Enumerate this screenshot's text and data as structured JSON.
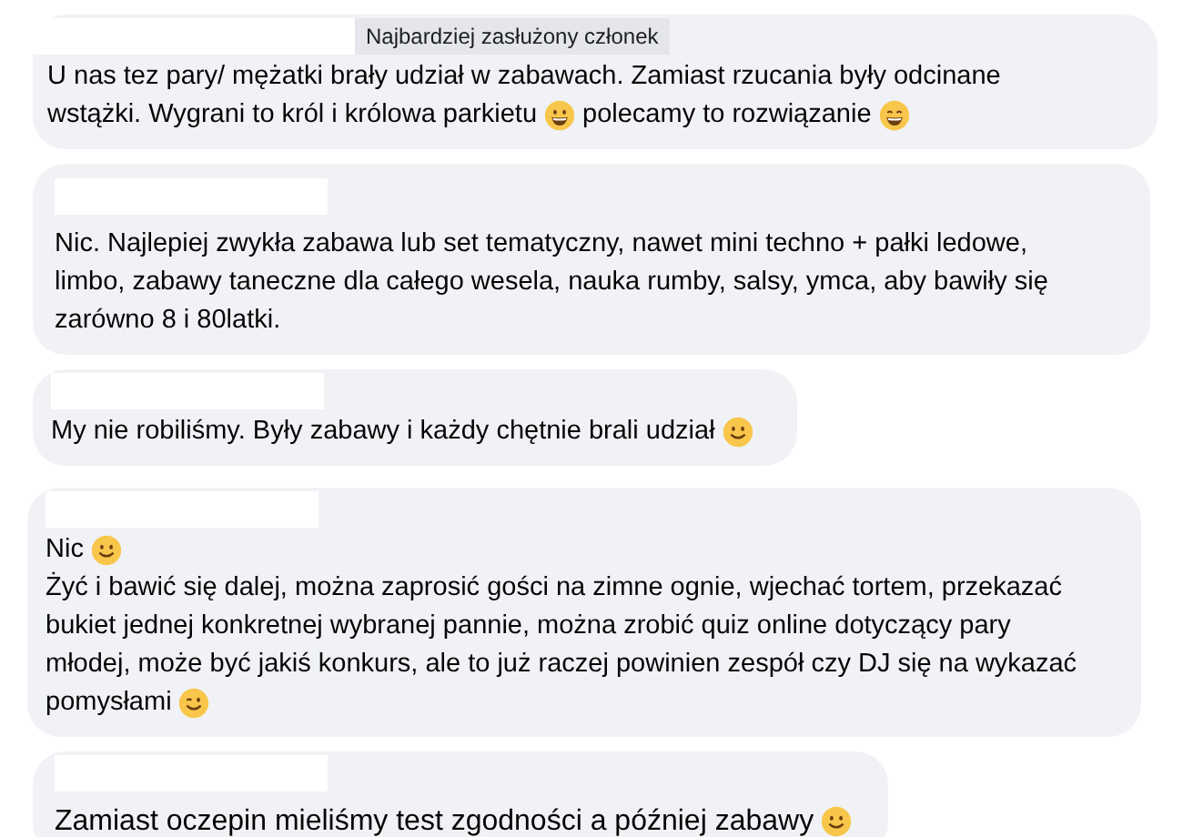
{
  "comments": [
    {
      "badge": "Najbardziej zasłużony członek",
      "lines": [
        [
          {
            "kind": "text",
            "text": "U nas tez pary/ mężatki brały udział w zabawach. Zamiast rzucania były odcinane"
          }
        ],
        [
          {
            "kind": "text",
            "text": "wstążki. Wygrani to król i królowa parkietu"
          },
          {
            "kind": "grin"
          },
          {
            "kind": "text",
            "text": "polecamy to rozwiązanie"
          },
          {
            "kind": "beam"
          }
        ]
      ]
    },
    {
      "lines": [
        [
          {
            "kind": "text",
            "text": "Nic. Najlepiej zwykła zabawa lub set tematyczny, nawet mini techno + pałki ledowe,"
          }
        ],
        [
          {
            "kind": "text",
            "text": "limbo, zabawy taneczne dla całego wesela, nauka rumby, salsy, ymca, aby bawiły się"
          }
        ],
        [
          {
            "kind": "text",
            "text": "zarówno 8 i 80latki."
          }
        ]
      ]
    },
    {
      "lines": [
        [
          {
            "kind": "text",
            "text": "My nie robiliśmy. Były zabawy i każdy chętnie brali udział"
          },
          {
            "kind": "smile"
          }
        ]
      ]
    },
    {
      "lines": [
        [
          {
            "kind": "text",
            "text": "Nic"
          },
          {
            "kind": "smile"
          }
        ],
        [
          {
            "kind": "text",
            "text": "Żyć i bawić się dalej, można zaprosić gości na zimne ognie, wjechać tortem, przekazać"
          }
        ],
        [
          {
            "kind": "text",
            "text": "bukiet jednej konkretnej wybranej pannie, można zrobić quiz online dotyczący pary"
          }
        ],
        [
          {
            "kind": "text",
            "text": "młodej, może być jakiś konkurs, ale to już raczej powinien zespół czy DJ się na wykazać"
          }
        ],
        [
          {
            "kind": "text",
            "text": "pomysłami"
          },
          {
            "kind": "wink"
          }
        ]
      ]
    },
    {
      "lines": [
        [
          {
            "kind": "text",
            "text": "Zamiast oczepin mieliśmy test zgodności a później zabawy"
          },
          {
            "kind": "smile"
          }
        ]
      ]
    }
  ]
}
